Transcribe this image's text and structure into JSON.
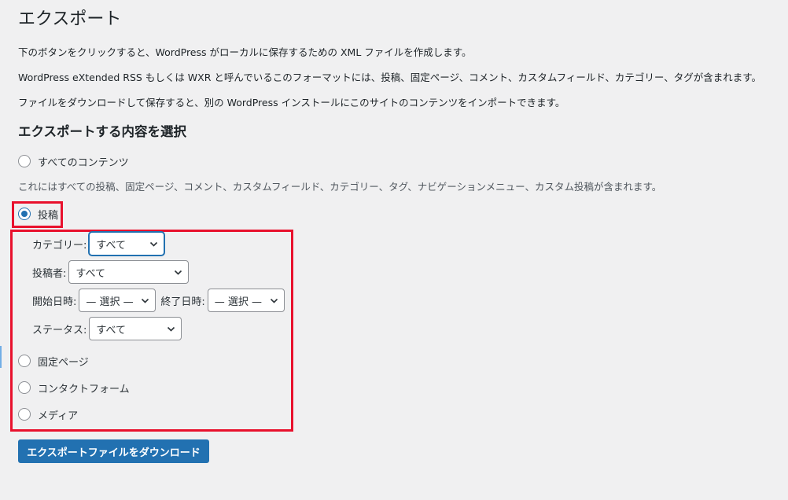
{
  "page": {
    "title": "エクスポート",
    "descriptions": [
      "下のボタンをクリックすると、WordPress がローカルに保存するための XML ファイルを作成します。",
      "WordPress eXtended RSS もしくは WXR と呼んでいるこのフォーマットには、投稿、固定ページ、コメント、カスタムフィールド、カテゴリー、タグが含まれます。",
      "ファイルをダウンロードして保存すると、別の WordPress インストールにこのサイトのコンテンツをインポートできます。"
    ],
    "section_heading": "エクスポートする内容を選択"
  },
  "options": {
    "all": {
      "label": "すべてのコンテンツ",
      "checked": false
    },
    "all_note": "これにはすべての投稿、固定ページ、コメント、カスタムフィールド、カテゴリー、タグ、ナビゲーションメニュー、カスタム投稿が含まれます。",
    "posts": {
      "label": "投稿",
      "checked": true
    },
    "pages": {
      "label": "固定ページ",
      "checked": false
    },
    "contact_forms": {
      "label": "コンタクトフォーム",
      "checked": false
    },
    "media": {
      "label": "メディア",
      "checked": false
    }
  },
  "filters": {
    "category": {
      "label": "カテゴリー:",
      "value": "すべて"
    },
    "author": {
      "label": "投稿者:",
      "value": "すべて"
    },
    "start_date": {
      "label": "開始日時:",
      "value": "— 選択 —"
    },
    "end_date": {
      "label": "終了日時:",
      "value": "— 選択 —"
    },
    "status": {
      "label": "ステータス:",
      "value": "すべて"
    }
  },
  "actions": {
    "download_label": "エクスポートファイルをダウンロード"
  },
  "colors": {
    "accent": "#2271b1",
    "highlight_box": "#e8112d",
    "background": "#f0f0f1"
  }
}
